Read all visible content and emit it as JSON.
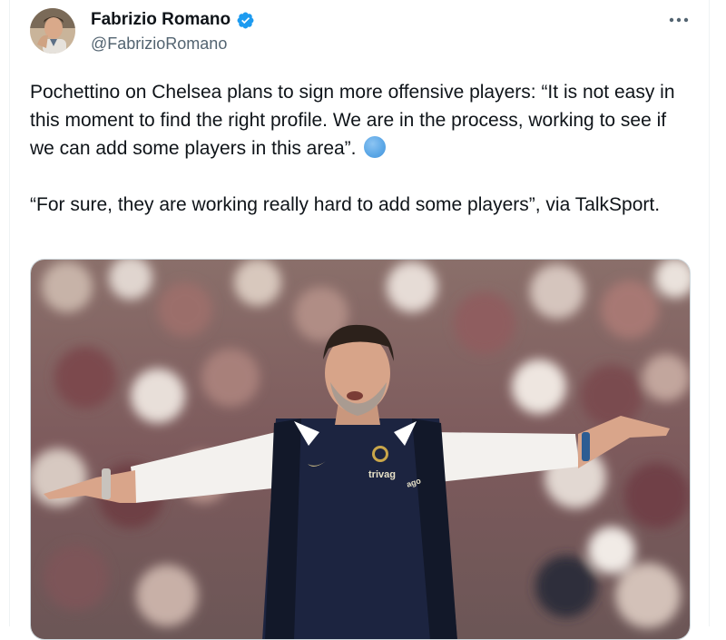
{
  "author": {
    "display_name": "Fabrizio Romano",
    "handle": "@FabrizioRomano",
    "verified": true,
    "avatar_icon": "profile-photo"
  },
  "actions": {
    "more_icon": "more-horizontal-icon"
  },
  "tweet": {
    "paragraph_1": "Pochettino on Chelsea plans to sign more offensive players: “It is not easy in this moment to find the right profile. We are in the process, working to see if we can add some players in this area”.",
    "paragraph_2": "“For sure, they are working really hard to add some players”, via TalkSport.",
    "emoji": "blue-circle"
  },
  "media": {
    "shirt_text_1": "trivag",
    "shirt_text_2": "ago"
  },
  "colors": {
    "text": "#0f1419",
    "secondary": "#536471",
    "verified_blue": "#1d9bf0",
    "border": "#eff3f4"
  }
}
